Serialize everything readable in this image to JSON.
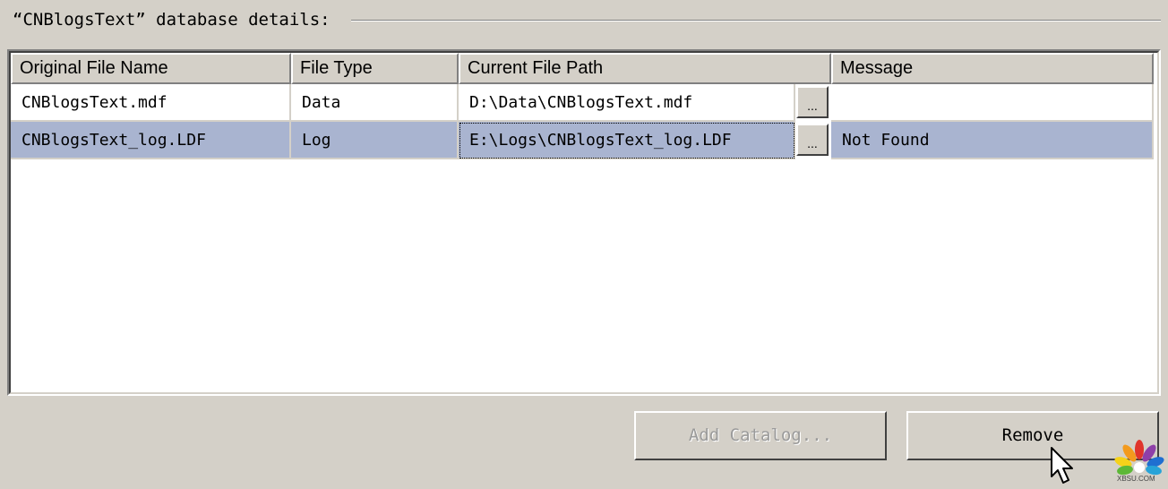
{
  "group": {
    "title": "“CNBlogsText” database details:"
  },
  "grid": {
    "columns": [
      "Original File Name",
      "File Type",
      "Current File Path",
      "Message"
    ],
    "rows": [
      {
        "original_name": "CNBlogsText.mdf",
        "file_type": "Data",
        "current_path": "D:\\Data\\CNBlogsText.mdf",
        "browse_label": "...",
        "message": ""
      },
      {
        "original_name": "CNBlogsText_log.LDF",
        "file_type": "Log",
        "current_path": "E:\\Logs\\CNBlogsText_log.LDF",
        "browse_label": "...",
        "message": "Not Found"
      }
    ],
    "selected_row": 1
  },
  "buttons": {
    "add_catalog": "Add Catalog...",
    "remove": "Remove"
  },
  "watermark": {
    "text": "XBSU.COM"
  },
  "colors": {
    "window_bg": "#d4d0c8",
    "selection": "#a9b4d0",
    "disabled_text": "#9a9a9a"
  },
  "icons": {
    "cursor": "arrow-cursor-icon",
    "logo": "peacock-logo-icon"
  }
}
